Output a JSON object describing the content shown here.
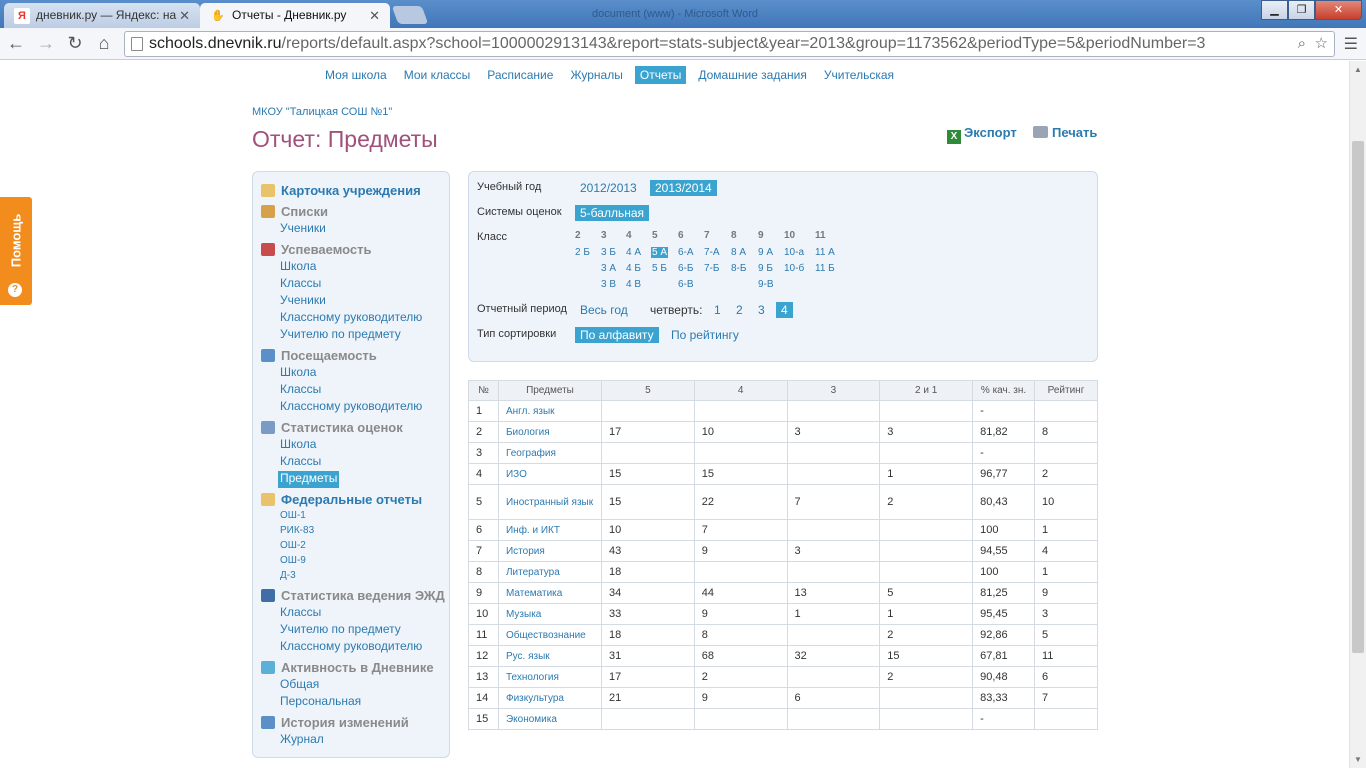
{
  "browser": {
    "tabs": [
      {
        "label": "дневник.ру — Яндекс: на",
        "favicon": "Я"
      },
      {
        "label": "Отчеты - Дневник.ру",
        "favicon": "👋"
      }
    ],
    "url_host": "schools.dnevnik.ru",
    "url_path": "/reports/default.aspx?school=1000002913143&report=stats-subject&year=2013&group=1173562&periodType=5&periodNumber=3",
    "ghost_title": "document (www) - Microsoft Word"
  },
  "help_label": "Помощь",
  "topnav": [
    {
      "label": "Моя школа"
    },
    {
      "label": "Мои классы"
    },
    {
      "label": "Расписание"
    },
    {
      "label": "Журналы"
    },
    {
      "label": "Отчеты",
      "active": true
    },
    {
      "label": "Домашние задания"
    },
    {
      "label": "Учительская"
    }
  ],
  "school_name": "МКОУ \"Талицкая СОШ №1\"",
  "page_title": "Отчет: Предметы",
  "actions": {
    "export": "Экспорт",
    "print": "Печать"
  },
  "sidebar": [
    {
      "title": "Карточка учреждения",
      "icon": "card-icon",
      "blue": true,
      "items": []
    },
    {
      "title": "Списки",
      "icon": "people-icon",
      "items": [
        "Ученики"
      ]
    },
    {
      "title": "Успеваемость",
      "icon": "bar-chart-icon",
      "items": [
        "Школа",
        "Классы",
        "Ученики",
        "Классному руководителю",
        "Учителю по предмету"
      ]
    },
    {
      "title": "Посещаемость",
      "icon": "calendar-icon",
      "items": [
        "Школа",
        "Классы",
        "Классному руководителю"
      ]
    },
    {
      "title": "Статистика оценок",
      "icon": "stats-icon",
      "items": [
        "Школа",
        "Классы",
        "Предметы"
      ],
      "active": "Предметы"
    },
    {
      "title": "Федеральные отчеты",
      "icon": "pencil-doc-icon",
      "blue": true,
      "small": true,
      "items": [
        "ОШ-1",
        "РИК-83",
        "ОШ-2",
        "ОШ-9",
        "Д-3"
      ]
    },
    {
      "title": "Статистика ведения ЭЖД",
      "icon": "book-icon",
      "items": [
        "Классы",
        "Учителю по предмету",
        "Классному руководителю"
      ]
    },
    {
      "title": "Активность в Дневнике",
      "icon": "activity-icon",
      "items": [
        "Общая",
        "Персональная"
      ]
    },
    {
      "title": "История изменений",
      "icon": "history-icon",
      "items": [
        "Журнал"
      ]
    }
  ],
  "filter": {
    "year_label": "Учебный год",
    "years": [
      "2012/2013",
      "2013/2014"
    ],
    "year_active": "2013/2014",
    "scale_label": "Системы оценок",
    "scale": "5-балльная",
    "class_label": "Класс",
    "grades": [
      {
        "g": "2",
        "classes": [
          "2 Б"
        ]
      },
      {
        "g": "3",
        "classes": [
          "3 Б",
          "3 А",
          "3 В"
        ]
      },
      {
        "g": "4",
        "classes": [
          "4 А",
          "4 Б",
          "4 В"
        ]
      },
      {
        "g": "5",
        "classes": [
          "5 А",
          "5 Б"
        ]
      },
      {
        "g": "6",
        "classes": [
          "6-А",
          "6-Б",
          "6-В"
        ]
      },
      {
        "g": "7",
        "classes": [
          "7-А",
          "7-Б"
        ]
      },
      {
        "g": "8",
        "classes": [
          "8 А",
          "8-Б"
        ]
      },
      {
        "g": "9",
        "classes": [
          "9 А",
          "9 Б",
          "9-В"
        ]
      },
      {
        "g": "10",
        "classes": [
          "10-а",
          "10-б"
        ]
      },
      {
        "g": "11",
        "classes": [
          "11 А",
          "11 Б"
        ]
      }
    ],
    "class_active": "5 А",
    "period_label": "Отчетный период",
    "period_all": "Весь год",
    "quarter_label": "четверть:",
    "quarters": [
      "1",
      "2",
      "3",
      "4"
    ],
    "quarter_active": "4",
    "sort_label": "Тип сортировки",
    "sort_options": [
      "По алфавиту",
      "По рейтингу"
    ],
    "sort_active": "По алфавиту"
  },
  "table": {
    "headers": [
      "№",
      "Предметы",
      "5",
      "4",
      "3",
      "2 и 1",
      "% кач. зн.",
      "Рейтинг"
    ],
    "rows": [
      [
        "1",
        "Англ. язык",
        "",
        "",
        "",
        "",
        "-",
        ""
      ],
      [
        "2",
        "Биология",
        "17",
        "10",
        "3",
        "3",
        "81,82",
        "8"
      ],
      [
        "3",
        "География",
        "",
        "",
        "",
        "",
        "-",
        ""
      ],
      [
        "4",
        "ИЗО",
        "15",
        "15",
        "",
        "1",
        "96,77",
        "2"
      ],
      [
        "5",
        "Иностранный язык",
        "15",
        "22",
        "7",
        "2",
        "80,43",
        "10"
      ],
      [
        "6",
        "Инф. и ИКТ",
        "10",
        "7",
        "",
        "",
        "100",
        "1"
      ],
      [
        "7",
        "История",
        "43",
        "9",
        "3",
        "",
        "94,55",
        "4"
      ],
      [
        "8",
        "Литература",
        "18",
        "",
        "",
        "",
        "100",
        "1"
      ],
      [
        "9",
        "Математика",
        "34",
        "44",
        "13",
        "5",
        "81,25",
        "9"
      ],
      [
        "10",
        "Музыка",
        "33",
        "9",
        "1",
        "1",
        "95,45",
        "3"
      ],
      [
        "11",
        "Обществознание",
        "18",
        "8",
        "",
        "2",
        "92,86",
        "5"
      ],
      [
        "12",
        "Рус. язык",
        "31",
        "68",
        "32",
        "15",
        "67,81",
        "11"
      ],
      [
        "13",
        "Технология",
        "17",
        "2",
        "",
        "2",
        "90,48",
        "6"
      ],
      [
        "14",
        "Физкультура",
        "21",
        "9",
        "6",
        "",
        "83,33",
        "7"
      ],
      [
        "15",
        "Экономика",
        "",
        "",
        "",
        "",
        "-",
        ""
      ]
    ]
  },
  "colors": {
    "accent": "#3ba3d0",
    "link": "#2c7ab0",
    "title": "#a0527b",
    "help": "#f28c1c"
  }
}
